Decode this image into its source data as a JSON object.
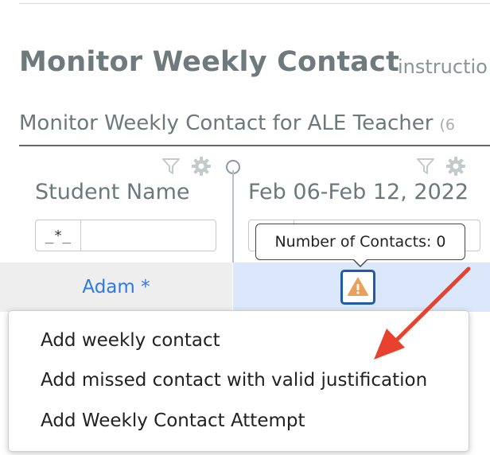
{
  "page": {
    "title": "Monitor Weekly Contact",
    "subtitle": "instructio"
  },
  "section": {
    "title": "Monitor Weekly Contact for ALE Teacher",
    "count": "(6"
  },
  "table": {
    "columns": [
      {
        "label": "Student Name",
        "filter_operator": "_*_",
        "filter_value": ""
      },
      {
        "label": "Feb 06-Feb 12, 2022",
        "filter_operator": "",
        "filter_value": ""
      }
    ],
    "rows": [
      {
        "student": "Adam *",
        "status_icon": "warning-icon"
      }
    ]
  },
  "tooltip": {
    "text": "Number of Contacts: 0"
  },
  "context_menu": {
    "items": [
      "Add weekly contact",
      "Add missed contact with valid justification",
      "Add Weekly Contact Attempt"
    ]
  },
  "colors": {
    "warning": "#e8a05a",
    "link": "#2e7ae0",
    "annotation_arrow": "#e8412e",
    "row_highlight": "#dbe7fb"
  }
}
